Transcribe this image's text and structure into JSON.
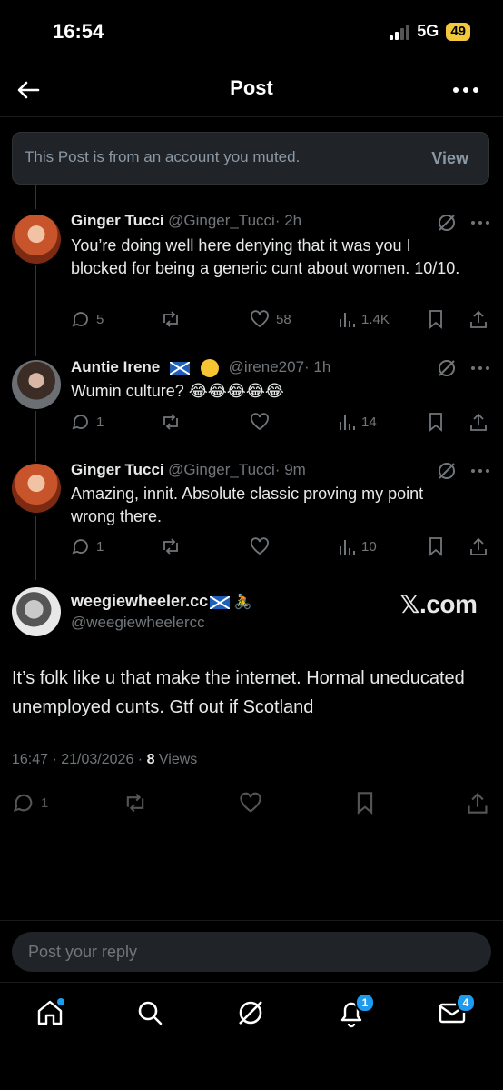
{
  "status_bar": {
    "time": "16:54",
    "network": "5G",
    "battery": "49"
  },
  "header": {
    "title": "Post"
  },
  "muted_notice": {
    "text": "This Post is from an account you muted.",
    "view_label": "View"
  },
  "replies": [
    {
      "name": "Ginger Tucci",
      "handle": "@Ginger_Tucci",
      "time": "· 2h",
      "text": "You’re doing well here denying that it was you I blocked for being a generic cunt about women. 10/10.",
      "replies": "5",
      "reposts": "",
      "likes": "58",
      "views": "1.4K"
    },
    {
      "name": "Auntie Irene",
      "name_emoji": "🏴󠁧󠁢󠁳󠁣󠁴󠁿 😊",
      "handle": "@irene207",
      "time": "· 1h",
      "text": "Wumin culture? 😂😂😂😂😂",
      "replies": "1",
      "reposts": "",
      "likes": "",
      "views": "14"
    },
    {
      "name": "Ginger Tucci",
      "handle": "@Ginger_Tucci",
      "time": "· 9m",
      "text": "Amazing, innit. Absolute classic proving my point wrong there.",
      "replies": "1",
      "reposts": "",
      "likes": "",
      "views": "10"
    }
  ],
  "main_post": {
    "name": "weegiewheeler.cc",
    "name_emoji": "🚴",
    "handle": "@weegiewheelercc",
    "watermark": "𝕏.com",
    "text": "It’s folk like u that make the internet. Hormal uneducated unemployed cunts. Gtf out if Scotland",
    "timestamp": "16:47 · 21/03/2026 · ",
    "views_count": "8",
    "views_label": " Views",
    "replies": "1"
  },
  "reply_box": {
    "placeholder": "Post your reply"
  },
  "bottom_nav": {
    "notifications_badge": "1",
    "messages_badge": "4"
  },
  "colors": {
    "accent": "#1d9bf0",
    "muted_text": "#71767b",
    "battery": "#f2c83c"
  }
}
